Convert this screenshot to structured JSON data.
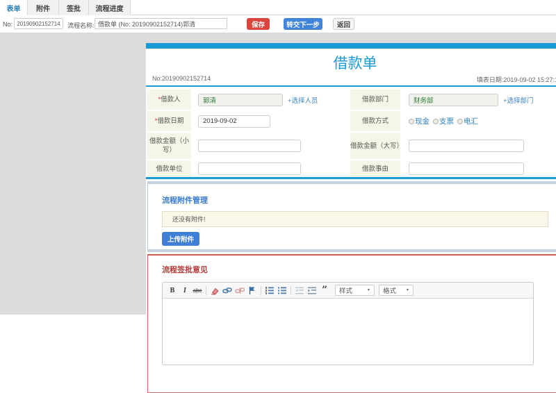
{
  "colors": {
    "accent_blue": "#199ad5",
    "save_red": "#d9453c",
    "primary_blue": "#4285d8",
    "section_blue": "#3a7ad0",
    "section_red": "#b03a35",
    "label_bg": "#f6f6e8"
  },
  "tabs": [
    {
      "label": "表单",
      "active": true
    },
    {
      "label": "附件",
      "active": false
    },
    {
      "label": "签批",
      "active": false
    },
    {
      "label": "流程进度",
      "active": false
    }
  ],
  "toolbar": {
    "no_label": "No:",
    "no_value": "20190902152714",
    "flow_label": "流程名称:",
    "flow_value": "借款单 (No: 20190902152714)郭清",
    "save": "保存",
    "next": "转交下一步",
    "back": "返回"
  },
  "doc": {
    "title": "借款单",
    "no_text": "No:20190902152714",
    "date_text": "填表日期:2019-09-02 15:27:1"
  },
  "form": {
    "rows": [
      {
        "l1star": "*",
        "l1": "借款人",
        "v1": "郭清",
        "link1": "+选择人员",
        "l2": "借款部门",
        "v2": "财务部",
        "link2": "+选择部门"
      },
      {
        "l1star": "*",
        "l1": "借款日期",
        "v1": "2019-09-02",
        "l2": "借款方式",
        "radios": [
          "现金",
          "支票",
          "电汇"
        ]
      },
      {
        "l1": "借款金额（小写）",
        "l2": "借款金额（大写）"
      },
      {
        "l1": "借款单位",
        "l2": "借款事由"
      }
    ]
  },
  "attachments": {
    "title": "流程附件管理",
    "empty": "还没有附件!",
    "upload": "上传附件"
  },
  "sign": {
    "title": "流程签批意见",
    "bold": "B",
    "italic": "I",
    "strike": "abc",
    "quote": "”",
    "style_dd": "样式",
    "format_dd": "格式"
  }
}
